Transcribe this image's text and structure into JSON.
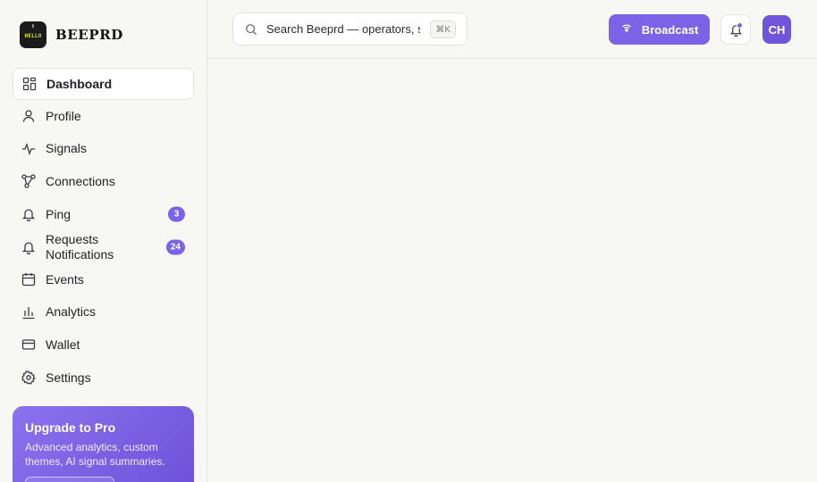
{
  "brand": {
    "logo_text": "HELLO",
    "name": "BEEPRD"
  },
  "sidebar": {
    "items": [
      {
        "label": "Dashboard",
        "icon": "dashboard-icon",
        "active": true
      },
      {
        "label": "Profile",
        "icon": "user-icon"
      },
      {
        "label": "Signals",
        "icon": "activity-icon"
      },
      {
        "label": "Connections",
        "icon": "network-icon"
      },
      {
        "label": "Ping",
        "icon": "bell-icon",
        "badge": "3"
      },
      {
        "label_line1": "Requests",
        "label_line2": "Notifications",
        "icon": "bell-icon",
        "badge": "24"
      },
      {
        "label": "Events",
        "icon": "calendar-icon"
      },
      {
        "label": "Analytics",
        "icon": "bar-chart-icon"
      },
      {
        "label": "Wallet",
        "icon": "credit-card-icon"
      },
      {
        "label": "Settings",
        "icon": "gear-icon"
      }
    ]
  },
  "upgrade": {
    "title": "Upgrade to Pro",
    "description": "Advanced analytics, custom themes, AI signal summaries."
  },
  "topbar": {
    "search_placeholder": "Search Beeprd — operators, signals, events",
    "search_shortcut": "⌘K",
    "broadcast_label": "Broadcast",
    "avatar_initials": "CH"
  },
  "colors": {
    "accent": "#7a63e6",
    "background": "#f7f7f4"
  }
}
